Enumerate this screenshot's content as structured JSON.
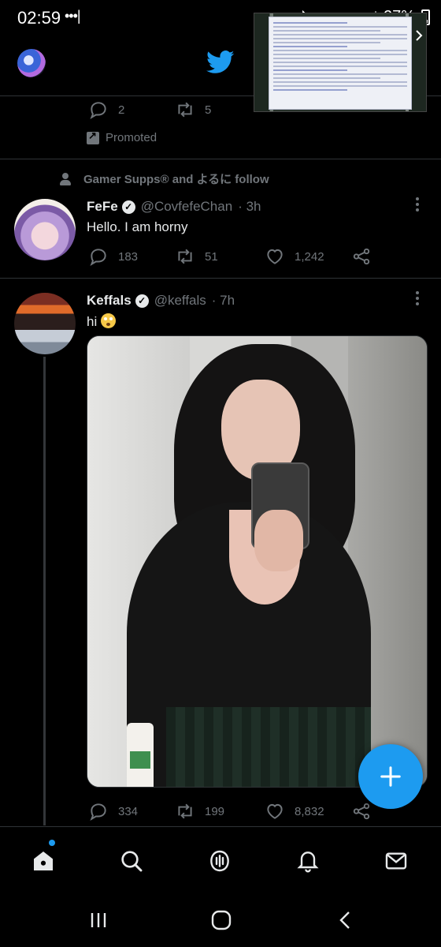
{
  "status_bar": {
    "time": "02:59",
    "dots": "•••|",
    "battery": "27%"
  },
  "promo_tweet": {
    "reply_count": "2",
    "retweet_count": "5",
    "promoted_label": "Promoted"
  },
  "tweets": [
    {
      "social_context": "Gamer Supps® and よるに follow",
      "display_name": "FeFe",
      "handle": "@CovfefeChan",
      "time": "· 3h",
      "text": "Hello. I am horny",
      "replies": "183",
      "retweets": "51",
      "likes": "1,242"
    },
    {
      "display_name": "Keffals",
      "handle": "@keffals",
      "time": "· 7h",
      "text": "hi",
      "replies": "334",
      "retweets": "199",
      "likes": "8,832"
    }
  ],
  "icons": {
    "compose": "plus-icon",
    "nav": [
      "home-icon",
      "search-icon",
      "spaces-icon",
      "notifications-icon",
      "messages-icon"
    ],
    "android": [
      "recent-apps-icon",
      "home-circle-icon",
      "back-icon"
    ]
  },
  "colors": {
    "accent": "#1d9bf0",
    "background": "#000000",
    "muted": "#71767b",
    "text": "#e7e9ea"
  }
}
